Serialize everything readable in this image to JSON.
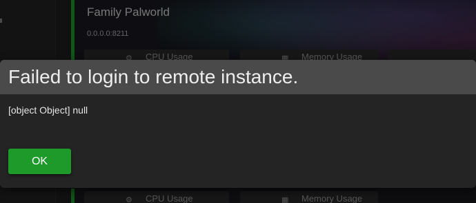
{
  "instance": {
    "name": "Family Palworld",
    "address": "0.0.0.0:8211",
    "stats": [
      {
        "icon": "chip-icon",
        "label": "CPU Usage"
      },
      {
        "icon": "memory-icon",
        "label": "Memory Usage"
      }
    ]
  },
  "dialog": {
    "title": "Failed to login to remote instance.",
    "message": "[object Object] null",
    "ok_label": "OK"
  },
  "colors": {
    "accent_green": "#1e9a2a",
    "dialog_header": "#4a4a4a",
    "dialog_body": "#242424"
  }
}
